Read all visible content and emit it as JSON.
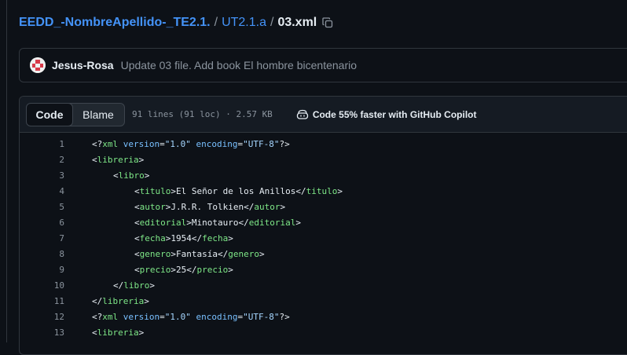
{
  "breadcrumb": {
    "repo": "EEDD_-NombreApellido-_TE2.1.",
    "sep1": "/",
    "dir": "UT2.1.a",
    "sep2": "/",
    "file": "03.xml"
  },
  "commit": {
    "author": "Jesus-Rosa",
    "message": "Update 03 file. Add book El hombre bicentenario"
  },
  "file_header": {
    "tabs": [
      {
        "label": "Code",
        "active": true
      },
      {
        "label": "Blame",
        "active": false
      }
    ],
    "info": "91 lines (91 loc) · 2.57 KB",
    "copilot_label": "Code 55% faster with GitHub Copilot"
  },
  "code": {
    "lines": [
      {
        "n": "1",
        "text": "<?xml version=\"1.0\" encoding=\"UTF-8\"?>",
        "kind": "decl",
        "indent": 0
      },
      {
        "n": "2",
        "text": "<libreria>",
        "kind": "tag",
        "indent": 0
      },
      {
        "n": "3",
        "text": "<libro>",
        "kind": "tag",
        "indent": 1
      },
      {
        "n": "4",
        "text": "<titulo>El Señor de los Anillos</titulo>",
        "kind": "elem",
        "tag": "titulo",
        "content": "El Señor de los Anillos",
        "indent": 2
      },
      {
        "n": "5",
        "text": "<autor>J.R.R. Tolkien</autor>",
        "kind": "elem",
        "tag": "autor",
        "content": "J.R.R. Tolkien",
        "indent": 2
      },
      {
        "n": "6",
        "text": "<editorial>Minotauro</editorial>",
        "kind": "elem",
        "tag": "editorial",
        "content": "Minotauro",
        "indent": 2
      },
      {
        "n": "7",
        "text": "<fecha>1954</fecha>",
        "kind": "elem",
        "tag": "fecha",
        "content": "1954",
        "indent": 2
      },
      {
        "n": "8",
        "text": "<genero>Fantasía</genero>",
        "kind": "elem",
        "tag": "genero",
        "content": "Fantasía",
        "indent": 2
      },
      {
        "n": "9",
        "text": "<precio>25</precio>",
        "kind": "elem",
        "tag": "precio",
        "content": "25",
        "indent": 2
      },
      {
        "n": "10",
        "text": "</libro>",
        "kind": "tag",
        "indent": 1
      },
      {
        "n": "11",
        "text": "</libreria>",
        "kind": "tag",
        "indent": 0
      },
      {
        "n": "12",
        "text": "<?xml version=\"1.0\" encoding=\"UTF-8\"?>",
        "kind": "decl",
        "indent": 0
      },
      {
        "n": "13",
        "text": "<libreria>",
        "kind": "tag",
        "indent": 0
      }
    ]
  },
  "colors": {
    "background": "#0d1117",
    "link": "#4493f8",
    "tag": "#7ee787",
    "attr": "#79c0ff",
    "string": "#a5d6ff",
    "muted": "#8b949e"
  }
}
